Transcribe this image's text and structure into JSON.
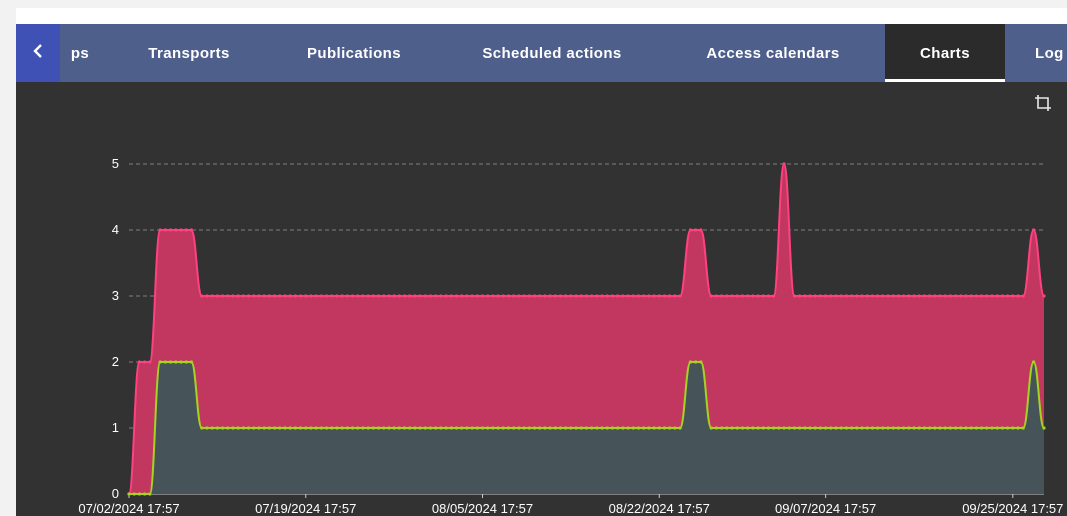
{
  "tabs": [
    {
      "label": "ps",
      "active": false
    },
    {
      "label": "Transports",
      "active": false
    },
    {
      "label": "Publications",
      "active": false
    },
    {
      "label": "Scheduled actions",
      "active": false
    },
    {
      "label": "Access calendars",
      "active": false
    },
    {
      "label": "Charts",
      "active": true
    },
    {
      "label": "Log",
      "active": false
    }
  ],
  "icons": {
    "back": "chevron-left-icon",
    "toolbar": "crop-icon"
  },
  "colors": {
    "tab_bar": "#4e5f8c",
    "back_button": "#3f51b5",
    "active_tab": "#2b2b2b",
    "chart_background": "#323232",
    "series_pink": "#ff4081",
    "series_pink_fill": "#c2375f",
    "series_green": "#a4d321",
    "series_green_fill": "#465459"
  },
  "chart_data": {
    "type": "area",
    "title": "",
    "xlabel": "",
    "ylabel": "",
    "ylim": [
      0,
      5
    ],
    "xlim": [
      "07/02/2024 17:57",
      "09/28/2024 17:57"
    ],
    "y_ticks": [
      "0",
      "1",
      "2",
      "3",
      "4",
      "5"
    ],
    "x_ticks": [
      "07/02/2024 17:57",
      "07/19/2024 17:57",
      "08/05/2024 17:57",
      "08/22/2024 17:57",
      "09/07/2024 17:57",
      "09/25/2024 17:57"
    ],
    "grid": "horizontal dashed",
    "series": [
      {
        "color": "#ff4081",
        "fill": "#c2375f",
        "points": [
          [
            "07/02/2024 17:57",
            0
          ],
          [
            "07/03/2024 17:57",
            2
          ],
          [
            "07/04/2024 17:57",
            2
          ],
          [
            "07/05/2024 17:57",
            4
          ],
          [
            "07/06/2024 17:57",
            4
          ],
          [
            "07/07/2024 17:57",
            4
          ],
          [
            "07/08/2024 17:57",
            4
          ],
          [
            "07/09/2024 17:57",
            3
          ],
          [
            "08/24/2024 17:57",
            3
          ],
          [
            "08/25/2024 17:57",
            4
          ],
          [
            "08/26/2024 17:57",
            4
          ],
          [
            "08/27/2024 17:57",
            3
          ],
          [
            "09/02/2024 17:57",
            3
          ],
          [
            "09/03/2024 17:57",
            5
          ],
          [
            "09/04/2024 17:57",
            3
          ],
          [
            "09/26/2024 17:57",
            3
          ],
          [
            "09/27/2024 17:57",
            4
          ],
          [
            "09/28/2024 17:57",
            3
          ]
        ]
      },
      {
        "color": "#a4d321",
        "fill": "#465459",
        "points": [
          [
            "07/02/2024 17:57",
            0
          ],
          [
            "07/04/2024 17:57",
            0
          ],
          [
            "07/05/2024 17:57",
            2
          ],
          [
            "07/06/2024 17:57",
            2
          ],
          [
            "07/07/2024 17:57",
            2
          ],
          [
            "07/08/2024 17:57",
            2
          ],
          [
            "07/09/2024 17:57",
            1
          ],
          [
            "08/24/2024 17:57",
            1
          ],
          [
            "08/25/2024 17:57",
            2
          ],
          [
            "08/26/2024 17:57",
            2
          ],
          [
            "08/27/2024 17:57",
            1
          ],
          [
            "09/26/2024 17:57",
            1
          ],
          [
            "09/27/2024 17:57",
            2
          ],
          [
            "09/28/2024 17:57",
            1
          ]
        ]
      }
    ]
  }
}
